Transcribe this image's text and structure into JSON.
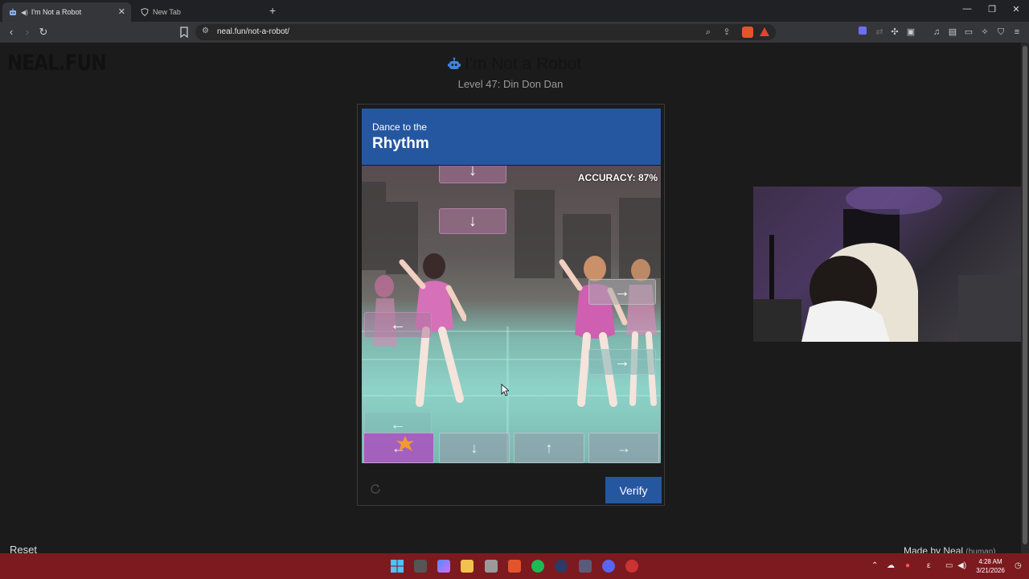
{
  "browser": {
    "tabs": [
      {
        "title": "I'm Not a Robot",
        "active": true
      },
      {
        "title": "New Tab",
        "active": false
      }
    ],
    "new_tab_symbol": "+",
    "url": "neal.fun/not-a-robot/",
    "window_controls": [
      "minimize-icon",
      "restore-icon",
      "close-icon"
    ]
  },
  "page": {
    "logo": "NEAL.FUN",
    "title": "I'm Not a Robot",
    "level": "Level 47: Din Don Dan"
  },
  "captcha": {
    "header_small": "Dance to the",
    "header_big": "Rhythm",
    "accuracy": "ACCURACY: 87%",
    "falling_notes": [
      {
        "arrow": "↓",
        "lane": 1,
        "style": "pink"
      },
      {
        "arrow": "↓",
        "lane": 1,
        "style": "pink"
      },
      {
        "arrow": "→",
        "lane": 3,
        "style": "gray"
      },
      {
        "arrow": "←",
        "lane": 0,
        "style": "pink"
      },
      {
        "arrow": "→",
        "lane": 3,
        "style": "teal"
      },
      {
        "arrow": "←",
        "lane": 0,
        "style": "teal"
      }
    ],
    "receptors": [
      {
        "arrow": "←",
        "active": true
      },
      {
        "arrow": "↓",
        "active": false
      },
      {
        "arrow": "↑",
        "active": false
      },
      {
        "arrow": "→",
        "active": false
      }
    ],
    "verify_label": "Verify"
  },
  "footer": {
    "reset_label": "Reset",
    "made_by": "Made by Neal",
    "made_by_note": "(human)"
  },
  "taskbar": {
    "time": "4:28 AM",
    "date": "3/21/2026"
  },
  "colors": {
    "captcha_blue": "#2557a0",
    "taskbar": "#7d1a1f",
    "page_bg": "#1b1b1b"
  }
}
